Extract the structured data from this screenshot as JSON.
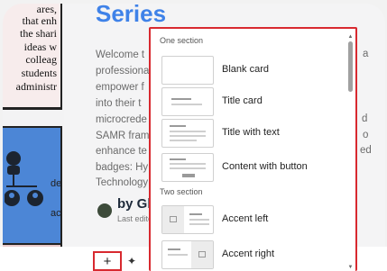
{
  "left_column": {
    "lines": [
      "ares,",
      "that enh",
      "the shari",
      "ideas w",
      "colleag",
      "students",
      "administr"
    ],
    "side_text": [
      "de",
      "ac"
    ]
  },
  "document": {
    "title": "Series",
    "paragraph_lines": [
      "Welcome t",
      "professiona",
      "empower f",
      "into their t",
      "microcrede",
      "SAMR fram",
      "enhance te",
      "badges: Hy",
      "Technology"
    ],
    "right_fragments": [
      "a",
      "d",
      "o",
      "ed"
    ],
    "author_name": "by Gl",
    "author_sub": "Last edite"
  },
  "toolbar": {
    "add_label": "+",
    "ai_label": "✦",
    "more_label": "⌄"
  },
  "panel": {
    "sections": [
      {
        "label": "One section",
        "options": [
          {
            "label": "Blank card"
          },
          {
            "label": "Title card"
          },
          {
            "label": "Title with text"
          },
          {
            "label": "Content with button"
          }
        ]
      },
      {
        "label": "Two section",
        "options": [
          {
            "label": "Accent left"
          },
          {
            "label": "Accent right"
          }
        ]
      }
    ]
  },
  "colors": {
    "accent_red": "#d8292f",
    "title_blue": "#3f82e8",
    "left_blue": "#4c86d6"
  }
}
